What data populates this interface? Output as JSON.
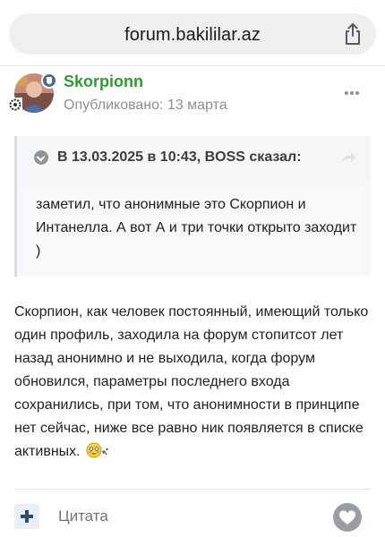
{
  "browser": {
    "url": "forum.bakililar.az",
    "share_icon": "share-icon"
  },
  "post": {
    "author": "Skorpionn",
    "published": "Опубликовано: 13 марта",
    "author_color": "#2e9c2e",
    "quote": {
      "attribution": "В 13.03.2025 в 10:43, BOSS сказал:",
      "text": "заметил, что анонимные это Скорпион и Интанелла. А вот А и три точки открыто заходит )"
    },
    "body": "Скорпион, как человек постоянный, имеющий только один профиль, заходила на форум стопитсот лет назад анонимно и не выходила, когда форум обновился, параметры последнего входа сохранились, при том, что анонимности в принципе нет сейчас, ниже все равно ник появляется в списке активных.",
    "emoji": "blushing-smiley-icon"
  },
  "actions": {
    "quote_label": "Цитата",
    "multiquote_icon": "plus-icon",
    "like_icon": "heart-icon"
  }
}
